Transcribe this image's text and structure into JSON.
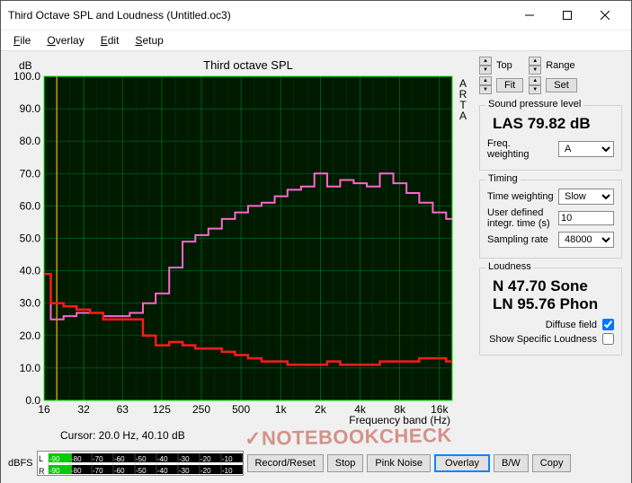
{
  "window": {
    "title": "Third Octave SPL and Loudness (Untitled.oc3)"
  },
  "menu": {
    "file": "File",
    "overlay": "Overlay",
    "edit": "Edit",
    "setup": "Setup"
  },
  "top_controls": {
    "top": "Top",
    "fit": "Fit",
    "range": "Range",
    "set": "Set"
  },
  "spl": {
    "group": "Sound pressure level",
    "value": "LAS 79.82 dB",
    "freq_weight_label": "Freq. weighting",
    "freq_weight_value": "A"
  },
  "timing": {
    "group": "Timing",
    "time_weight_label": "Time weighting",
    "time_weight_value": "Slow",
    "integ_label": "User defined integr. time (s)",
    "integ_value": "10",
    "rate_label": "Sampling rate",
    "rate_value": "48000"
  },
  "loudness": {
    "group": "Loudness",
    "n": "N 47.70 Sone",
    "ln": "LN 95.76 Phon",
    "diffuse_label": "Diffuse field",
    "specific_label": "Show Specific Loudness"
  },
  "cursor": "Cursor:   20.0 Hz, 40.10 dB",
  "plot": {
    "title": "Third octave SPL",
    "ylabel": "dB",
    "xlabel": "Frequency band (Hz)",
    "side": "ARTA"
  },
  "meter": {
    "label_left": "dBFS",
    "L": "L",
    "R": "R",
    "ticks": [
      "-90",
      "-80",
      "-70",
      "-60",
      "-50",
      "-40",
      "-30",
      "-20",
      "-10",
      "dB"
    ]
  },
  "buttons": {
    "record": "Record/Reset",
    "stop": "Stop",
    "pink": "Pink Noise",
    "overlay": "Overlay",
    "bw": "B/W",
    "copy": "Copy"
  },
  "chart_data": {
    "type": "bar",
    "title": "Third octave SPL",
    "xlabel": "Frequency band (Hz)",
    "ylabel": "dB",
    "ylim": [
      0,
      100
    ],
    "x_ticks": [
      16,
      32,
      63,
      125,
      250,
      500,
      "1k",
      "2k",
      "4k",
      "8k",
      "16k"
    ],
    "categories_hz": [
      16,
      20,
      25,
      31.5,
      40,
      50,
      63,
      80,
      100,
      125,
      160,
      200,
      250,
      315,
      400,
      500,
      630,
      800,
      1000,
      1250,
      1600,
      2000,
      2500,
      3150,
      4000,
      5000,
      6300,
      8000,
      10000,
      12500,
      16000,
      20000
    ],
    "series": [
      {
        "name": "Overlay SPL (pink)",
        "color": "#ff66cc",
        "values": [
          39,
          25,
          26,
          27,
          27,
          26,
          26,
          27,
          30,
          33,
          41,
          49,
          51,
          53,
          56,
          58,
          60,
          61,
          63,
          65,
          66,
          70,
          66,
          68,
          67,
          66,
          70,
          67,
          64,
          61,
          58,
          56
        ]
      },
      {
        "name": "Current SPL (red)",
        "color": "#ff1a1a",
        "values": [
          39,
          30,
          29,
          28,
          27,
          25,
          25,
          25,
          20,
          17,
          18,
          17,
          16,
          16,
          15,
          14,
          13,
          12,
          12,
          11,
          11,
          11,
          12,
          11,
          11,
          11,
          12,
          12,
          12,
          13,
          13,
          12
        ]
      }
    ],
    "cursor": {
      "hz": 20.0,
      "db": 40.1
    }
  }
}
